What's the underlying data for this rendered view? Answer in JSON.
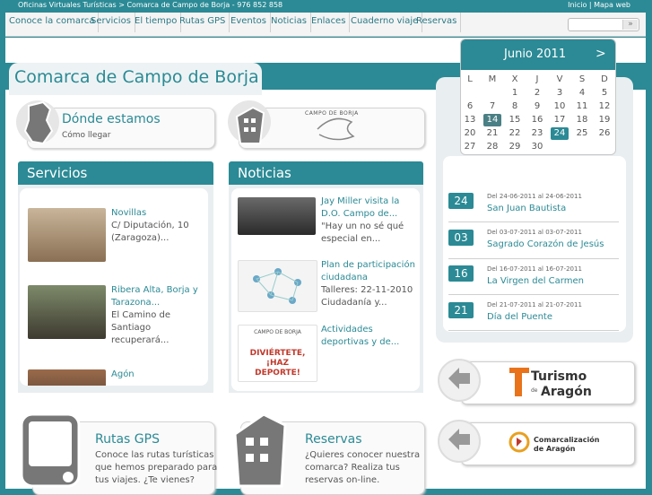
{
  "topbar": {
    "breadcrumb": "Oficinas Virtuales Turísticas > Comarca de Campo de Borja - 976 852 858",
    "links": "Inicio | Mapa web"
  },
  "nav": {
    "items": [
      "Conoce la comarca",
      "Servicios",
      "El tiempo",
      "Rutas GPS",
      "Eventos",
      "Noticias",
      "Enlaces",
      "Cuaderno viaje",
      "Reservas"
    ]
  },
  "search": {
    "placeholder": "",
    "button": "»"
  },
  "page_title": "Comarca de Campo de Borja",
  "donde": {
    "title": "Dónde estamos",
    "subtitle": "Cómo llegar"
  },
  "logo_text": "CAMPO DE BORJA",
  "servicios": {
    "title": "Servicios",
    "items": [
      {
        "title": "Novillas",
        "lines": [
          "C/ Diputación, 10",
          "(Zaragoza)..."
        ]
      },
      {
        "title": "Ribera Alta, Borja y",
        "title2": "Tarazona...",
        "lines": [
          "El Camino de",
          "Santiago",
          "recuperará..."
        ]
      },
      {
        "title": "Agón",
        "lines": []
      }
    ]
  },
  "noticias": {
    "title": "Noticias",
    "items": [
      {
        "title": "Jay Miller visita la",
        "title2": "D.O. Campo de...",
        "lines": [
          "\"Hay un no sé qué",
          "especial en..."
        ]
      },
      {
        "title": "Plan de participación",
        "title2": "ciudadana",
        "lines": [
          "Talleres: 22-11-2010",
          "Ciudadanía y..."
        ]
      },
      {
        "title": "Actividades",
        "title2": "deportivas y de...",
        "lines": []
      }
    ],
    "poster_top": "CAMPO DE BORJA",
    "poster_main": "DIVIÉRTETE, ¡HAZ DEPORTE!"
  },
  "rutas": {
    "title": "Rutas GPS",
    "lines": [
      "Conoce las rutas turísticas",
      "que hemos preparado para",
      "tus viajes. ¿Te vienes?"
    ]
  },
  "reservas": {
    "title": "Reservas",
    "lines": [
      "¿Quieres conocer nuestra",
      "comarca? Realiza tus",
      "reservas on-line."
    ]
  },
  "calendar": {
    "month": "Junio 2011",
    "next": ">",
    "weekdays": [
      "L",
      "M",
      "X",
      "J",
      "V",
      "S",
      "D"
    ],
    "weeks": [
      [
        "",
        "",
        "1",
        "2",
        "3",
        "4",
        "5"
      ],
      [
        "6",
        "7",
        "8",
        "9",
        "10",
        "11",
        "12"
      ],
      [
        "13",
        "14",
        "15",
        "16",
        "17",
        "18",
        "19"
      ],
      [
        "20",
        "21",
        "22",
        "23",
        "24",
        "25",
        "26"
      ],
      [
        "27",
        "28",
        "29",
        "30",
        "",
        "",
        ""
      ]
    ],
    "today": "14",
    "event_day": "24"
  },
  "events": [
    {
      "day": "24",
      "date": "Del 24-06-2011 al 24-06-2011",
      "title": "San Juan Bautista"
    },
    {
      "day": "03",
      "date": "Del 03-07-2011 al 03-07-2011",
      "title": "Sagrado Corazón de Jesús"
    },
    {
      "day": "16",
      "date": "Del 16-07-2011 al 16-07-2011",
      "title": "La Virgen del Carmen"
    },
    {
      "day": "21",
      "date": "Del 21-07-2011 al 21-07-2011",
      "title": "Día del Puente"
    }
  ],
  "partners": {
    "turismo_line1": "Turismo",
    "turismo_small": "de",
    "turismo_line2": "Aragón",
    "comarca_line1": "Comarcalización",
    "comarca_line2": "de Aragón"
  },
  "colors": {
    "accent": "#2b8a95",
    "background": "#2b8a95",
    "card": "#e9eef0"
  },
  "icons": [
    "map-icon",
    "phone-icon",
    "building-icon",
    "arrow-icon"
  ]
}
